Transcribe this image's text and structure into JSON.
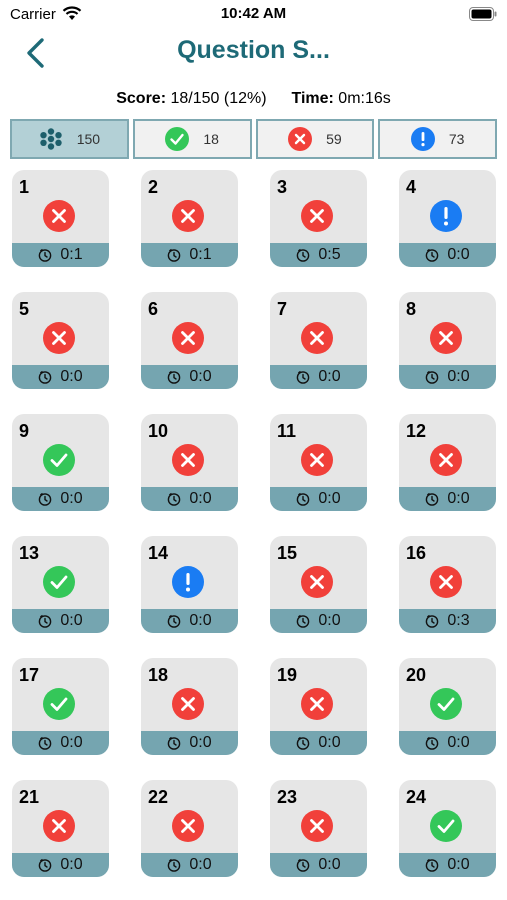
{
  "status_bar": {
    "carrier": "Carrier",
    "time": "10:42 AM"
  },
  "nav": {
    "title": "Question S..."
  },
  "summary": {
    "score_label": "Score:",
    "score_value": "18/150 (12%)",
    "time_label": "Time:",
    "time_value": "0m:16s"
  },
  "filters": [
    {
      "icon": "all-questions-icon",
      "count": "150",
      "active": true
    },
    {
      "icon": "correct-icon",
      "count": "18",
      "active": false
    },
    {
      "icon": "wrong-icon",
      "count": "59",
      "active": false
    },
    {
      "icon": "flagged-icon",
      "count": "73",
      "active": false
    }
  ],
  "questions": [
    {
      "number": "1",
      "status": "wrong",
      "time": "0:1"
    },
    {
      "number": "2",
      "status": "wrong",
      "time": "0:1"
    },
    {
      "number": "3",
      "status": "wrong",
      "time": "0:5"
    },
    {
      "number": "4",
      "status": "flag",
      "time": "0:0"
    },
    {
      "number": "5",
      "status": "wrong",
      "time": "0:0"
    },
    {
      "number": "6",
      "status": "wrong",
      "time": "0:0"
    },
    {
      "number": "7",
      "status": "wrong",
      "time": "0:0"
    },
    {
      "number": "8",
      "status": "wrong",
      "time": "0:0"
    },
    {
      "number": "9",
      "status": "right",
      "time": "0:0"
    },
    {
      "number": "10",
      "status": "wrong",
      "time": "0:0"
    },
    {
      "number": "11",
      "status": "wrong",
      "time": "0:0"
    },
    {
      "number": "12",
      "status": "wrong",
      "time": "0:0"
    },
    {
      "number": "13",
      "status": "right",
      "time": "0:0"
    },
    {
      "number": "14",
      "status": "flag",
      "time": "0:0"
    },
    {
      "number": "15",
      "status": "wrong",
      "time": "0:0"
    },
    {
      "number": "16",
      "status": "wrong",
      "time": "0:3"
    },
    {
      "number": "17",
      "status": "right",
      "time": "0:0"
    },
    {
      "number": "18",
      "status": "wrong",
      "time": "0:0"
    },
    {
      "number": "19",
      "status": "wrong",
      "time": "0:0"
    },
    {
      "number": "20",
      "status": "right",
      "time": "0:0"
    },
    {
      "number": "21",
      "status": "wrong",
      "time": "0:0"
    },
    {
      "number": "22",
      "status": "wrong",
      "time": "0:0"
    },
    {
      "number": "23",
      "status": "wrong",
      "time": "0:0"
    },
    {
      "number": "24",
      "status": "right",
      "time": "0:0"
    }
  ],
  "colors": {
    "accent": "#1e6a77",
    "wrong": "#f1403a",
    "right": "#34c759",
    "flag": "#1a7cf3",
    "card_footer": "#75a5b0"
  }
}
